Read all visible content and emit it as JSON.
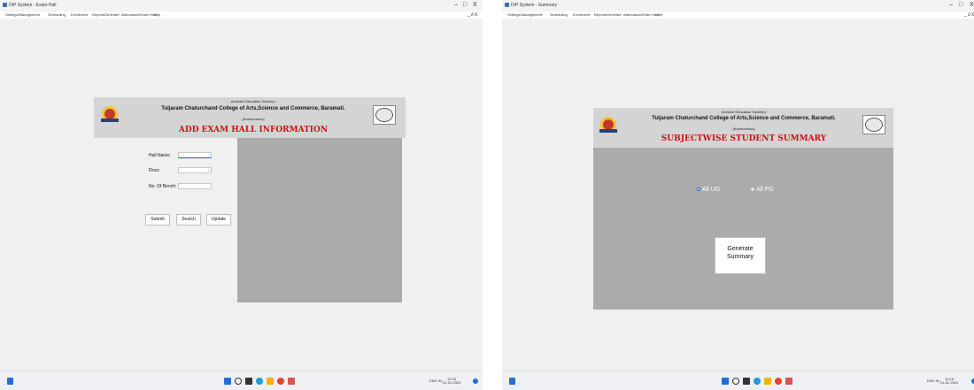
{
  "left": {
    "window_title": "DIP System - Exam Hall",
    "menu": [
      "Settings/Management",
      "Scheduling",
      "Enrollment",
      "Reports",
      "Generate",
      "Attendance/Exam Hall",
      "Help"
    ],
    "header": {
      "society": "Anekant Education Society's",
      "college": "Tuljaram Chaturchand College of Arts,Science and Commerce, Baramati.",
      "autonomous": "(Autonomous)",
      "form_title": "ADD EXAM HALL INFORMATION"
    },
    "fields": {
      "hall_name_label": "Hall Name:",
      "floor_label": "Floor:",
      "benches_label": "No. Of Bench:",
      "hall_name_value": "",
      "floor_value": "",
      "benches_value": ""
    },
    "buttons": {
      "submit": "Submit",
      "search": "Search",
      "update": "Update"
    }
  },
  "right": {
    "window_title": "DIP System - Summary",
    "menu": [
      "Settings/Management",
      "Scheduling",
      "Enrollment",
      "Reports",
      "Generate",
      "Attendance/Exam Hall",
      "Help"
    ],
    "header": {
      "society": "Anekant Education Society's",
      "college": "Tuljaram Chaturchand College of Arts,Science and Commerce, Baramati.",
      "autonomous": "(Autonomous)",
      "form_title": "SUBJECTWISE STUDENT SUMMARY"
    },
    "radios": {
      "all_ug": "All UG",
      "all_pg": "All PG",
      "selected": "All UG"
    },
    "generate_button_line1": "Generate",
    "generate_button_line2": "Summary"
  },
  "window_controls": {
    "minimize": "–",
    "maximize": "□",
    "close": "X"
  },
  "menu_right_controls": "_ ∂ X",
  "taskbar": {
    "left_tray": {
      "lang": "ENG IN",
      "time": "10:15",
      "date": "01-01-2024"
    },
    "right_tray": {
      "lang": "ENG IN",
      "time": "10:16",
      "date": "01-01-2024"
    }
  },
  "colors": {
    "title_red": "#cc1111",
    "panel_gray": "#ababab",
    "header_gray": "#d4d4d4",
    "accent_blue": "#1f6fd6"
  }
}
